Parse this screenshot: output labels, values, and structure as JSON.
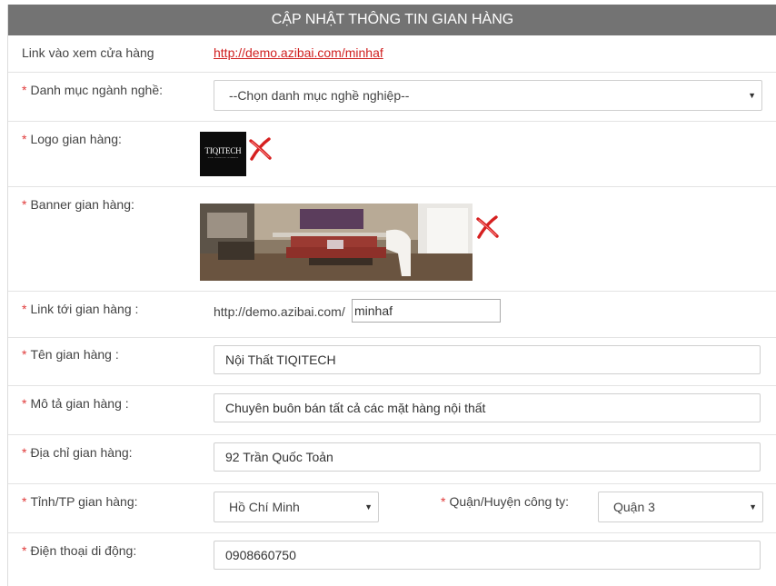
{
  "header": {
    "title": "CẬP NHẬT THÔNG TIN GIAN HÀNG"
  },
  "rows": {
    "view_link": {
      "label": "Link vào xem cửa hàng",
      "url": "http://demo.azibai.com/minhaf"
    },
    "category": {
      "label": "Danh mục ngành nghề:",
      "value": "--Chọn danh mục nghề nghiệp--"
    },
    "logo": {
      "label": "Logo gian hàng:",
      "logo_text": "TIQITECH",
      "logo_sub": "ECLAT TECHNOLOGY OF FASHION"
    },
    "banner": {
      "label": "Banner gian hàng:"
    },
    "shop_link": {
      "label": "Link tới gian hàng :",
      "prefix": "http://demo.azibai.com/",
      "value": "minhaf"
    },
    "shop_name": {
      "label": "Tên gian hàng :",
      "value": "Nội Thất TIQITECH"
    },
    "description": {
      "label": "Mô tả gian hàng :",
      "value": "Chuyên buôn bán tất cả các mặt hàng nội thất"
    },
    "address": {
      "label": "Địa chỉ gian hàng:",
      "value": "92 Trần Quốc Toản"
    },
    "province": {
      "label": "Tỉnh/TP gian hàng:",
      "value": "Hồ Chí Minh"
    },
    "district": {
      "label": "Quận/Huyện công ty:",
      "value": "Quận 3"
    },
    "phone": {
      "label": "Điện thoại di động:",
      "value": "0908660750"
    }
  },
  "required_marker": "*",
  "colors": {
    "header_bg": "#737373",
    "required": "#e03a3a",
    "link": "#d01f1f",
    "delete_icon": "#d62020"
  }
}
